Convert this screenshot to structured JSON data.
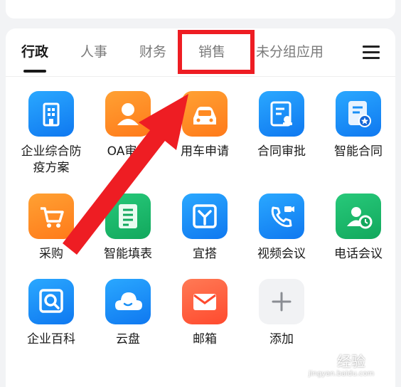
{
  "tabs": [
    {
      "label": "行政",
      "active": true
    },
    {
      "label": "人事"
    },
    {
      "label": "财务"
    },
    {
      "label": "销售"
    },
    {
      "label": "未分组应用"
    }
  ],
  "apps": [
    {
      "label": "企业综合防\n疫方案",
      "icon": "building-icon",
      "color": "#1a8ff5"
    },
    {
      "label": "OA审批",
      "icon": "person-badge-icon",
      "color": "#ff8a22"
    },
    {
      "label": "用车申请",
      "icon": "car-icon",
      "color": "#ff8a22"
    },
    {
      "label": "合同审批",
      "icon": "contract-stamp-icon",
      "color": "#1a8ff5"
    },
    {
      "label": "智能合同",
      "icon": "smart-contract-icon",
      "color": "#1a8ff5"
    },
    {
      "label": "采购",
      "icon": "cart-icon",
      "color": "#ff8a22"
    },
    {
      "label": "智能填表",
      "icon": "form-icon",
      "color": "#1db56a"
    },
    {
      "label": "宜搭",
      "icon": "yida-icon",
      "color": "#1a8ff5"
    },
    {
      "label": "视频会议",
      "icon": "video-call-icon",
      "color": "#1a8ff5"
    },
    {
      "label": "电话会议",
      "icon": "phone-meeting-icon",
      "color": "#1db56a"
    },
    {
      "label": "企业百科",
      "icon": "encyclopedia-search-icon",
      "color": "#1a8ff5"
    },
    {
      "label": "云盘",
      "icon": "cloud-drive-icon",
      "color": "#1a8ff5"
    },
    {
      "label": "邮箱",
      "icon": "mail-icon",
      "color": "#ff5a35"
    },
    {
      "label": "添加",
      "icon": "plus-icon",
      "color": "#f1f2f4"
    }
  ],
  "watermark": {
    "brand": "经验",
    "url": "jingyan.baidu.com"
  },
  "annotation": {
    "highlight_color": "#ee1d23"
  }
}
